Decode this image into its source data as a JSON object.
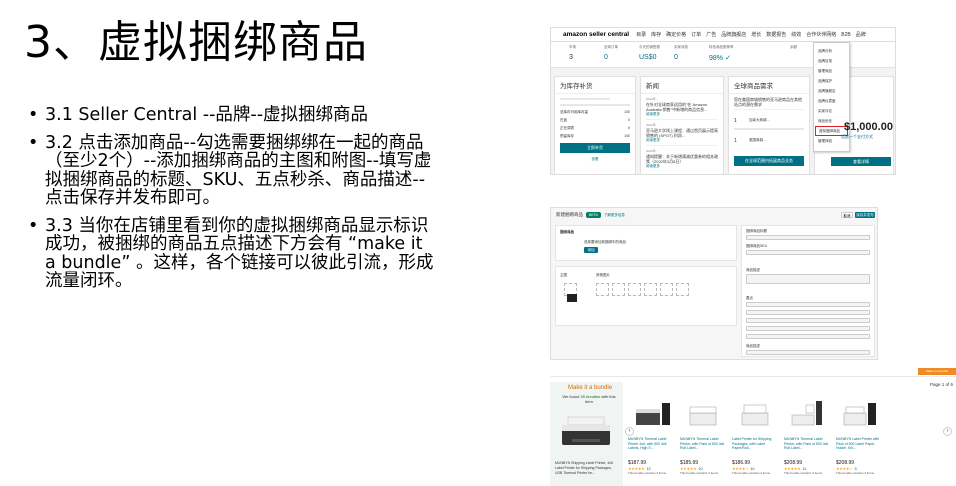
{
  "slide": {
    "title": "3、虚拟捆绑商品",
    "bullets": [
      "3.1 Seller Central --品牌--虚拟捆绑商品",
      "3.2 点击添加商品--勾选需要捆绑绑在一起的商品（至少2个）--添加捆绑商品的主图和附图--填写虚拟捆绑商品的标题、SKU、五点秒杀、商品描述--点击保存并发布即可。",
      "3.3 当你在店铺里看到你的虚拟捆绑商品显示标识成功，被捆绑的商品五点描述下方会有 “make it a bundle” 。这样，各个链接可以彼此引流，形成流量闭环。"
    ]
  },
  "seller_central": {
    "logo": "amazon seller central",
    "nav": [
      "目录",
      "库存",
      "确定价格",
      "订单",
      "广告",
      "品牌旗舰店",
      "增长",
      "数据报告",
      "绩效",
      "合作伙伴网络",
      "B2B",
      "品牌"
    ],
    "stats": [
      {
        "label": "市场",
        "value": "3"
      },
      {
        "label": "全球订单",
        "value": "0"
      },
      {
        "label": "今天的销售额",
        "value": "US$0"
      },
      {
        "label": "买家消息",
        "value": "0"
      },
      {
        "label": "特色商品推荐率",
        "value": "98% ✓"
      },
      {
        "label": "余额",
        "value": ""
      },
      {
        "label": "",
        "value": "647"
      }
    ],
    "cards": {
      "replenish": {
        "title": "为库存补货",
        "rows": [
          [
            "总库存可用库存量",
            "100"
          ],
          [
            "在途",
            "0"
          ],
          [
            "正在调拨",
            "0"
          ],
          [
            "预留库存",
            "100"
          ]
        ],
        "button": "立即补货",
        "link": "查看"
      },
      "news": {
        "title": "新闻",
        "items": [
          {
            "date": "2022年...",
            "text": "在针对全球商家适用的\"在 Amazon Australia 销售\"中新增的商品信息...",
            "link": "阅读更多"
          },
          {
            "date": "2022年...",
            "text": "亚马逊大学线上课程：通过首页展示提高销售的 (SPOT) 利润...",
            "link": "阅读更多"
          },
          {
            "date": "2022年...",
            "text": "通知提醒：关于新增满减优惠券的相关政策（2022年3月8日）",
            "link": "阅读更多"
          }
        ]
      },
      "global": {
        "title": "全球商品需求",
        "intro": "您在美国商城销售的亚马逊商品在其他站点的潜在需求",
        "rows": [
          [
            "1",
            "加拿大商城..."
          ],
          [
            "1",
            "英国商城..."
          ]
        ],
        "button": "在全球范围内拓展商品业务"
      }
    },
    "brand_menu": [
      "品牌分析",
      "品牌目录",
      "管理商品",
      "品牌保护",
      "品牌旗舰店",
      "品牌仪表盘",
      "买家评论",
      "商品优化",
      "虚拟捆绑商品",
      "管理体验"
    ],
    "balance": "$1,000.00",
    "side_link": "设置一个支付方式",
    "side_button": "查看详情"
  },
  "bundle_form": {
    "title": "新建捆绑商品",
    "badge": "BETA",
    "help_link": "了解更多信息",
    "cancel": "取消",
    "save": "保存并发布",
    "sections": {
      "products": "捆绑商品",
      "add_products": "选择要添加到捆绑中的商品",
      "add_button": "添加",
      "main_image": "主图",
      "more_images": "其他图片"
    },
    "fields": [
      "捆绑商品标题",
      "捆绑商品SKU",
      "商品描述",
      "要点",
      "商品描述"
    ]
  },
  "bundle_widget": {
    "top_badge": "Make it a bundle",
    "page": "Page 1 of 6",
    "title": "Make it a bundle",
    "subtitle_pre": "We found ",
    "subtitle_count": "35 bundles",
    "subtitle_post": " with this item",
    "main_desc": "MUNBYN Shipping Label Printer, 4x6 Label Printer for Shipping Packages, USB Thermal Printer for...",
    "items": [
      {
        "name": "MUNBYN Thermal Label Printer 4x6, with 500 4x6 Labels, High S...",
        "price": "$187.99",
        "stars": "★★★★★",
        "count": "13",
        "foot": "This bundle contains 3 items"
      },
      {
        "name": "MUNBYN Thermal Label Printer, with Pack of 500 4x6 Roll Label...",
        "price": "$185.99",
        "stars": "★★★★★",
        "count": "10",
        "foot": "This bundle contains 2 items"
      },
      {
        "name": "Label Printer for Shipping Packages, with Label Paper/Roll...",
        "price": "$186.99",
        "stars": "★★★★☆",
        "count": "10",
        "foot": "This bundle contains 2 items"
      },
      {
        "name": "MUNBYN Thermal Label Printer, with Pack of 500 4x6 Roll Label...",
        "price": "$208.99",
        "stars": "★★★★★",
        "count": "11",
        "foot": "This bundle contains 3 items"
      },
      {
        "name": "MUNBYN Label Printer with Pack of 500 Label Paper, Holder, Shi...",
        "price": "$208.99",
        "stars": "★★★★☆",
        "count": "5",
        "foot": "This bundle contains 3 items"
      }
    ]
  }
}
